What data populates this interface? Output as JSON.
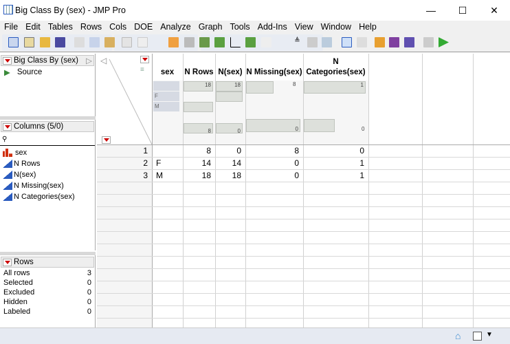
{
  "window": {
    "title": "Big Class By (sex) - JMP Pro",
    "minimize": "—",
    "maximize": "☐",
    "close": "✕"
  },
  "menu": [
    "File",
    "Edit",
    "Tables",
    "Rows",
    "Cols",
    "DOE",
    "Analyze",
    "Graph",
    "Tools",
    "Add-Ins",
    "View",
    "Window",
    "Help"
  ],
  "table_panel": {
    "title": "Big Class By (sex)",
    "source": "Source"
  },
  "columns_panel": {
    "title": "Columns (5/0)",
    "search_placeholder": "",
    "items": [
      "sex",
      "N Rows",
      "N(sex)",
      "N Missing(sex)",
      "N Categories(sex)"
    ]
  },
  "rows_panel": {
    "title": "Rows",
    "items": [
      {
        "label": "All rows",
        "value": "3"
      },
      {
        "label": "Selected",
        "value": "0"
      },
      {
        "label": "Excluded",
        "value": "0"
      },
      {
        "label": "Hidden",
        "value": "0"
      },
      {
        "label": "Labeled",
        "value": "0"
      }
    ]
  },
  "table": {
    "headers": [
      "sex",
      "N Rows",
      "N(sex)",
      "N Missing(sex)",
      "N",
      "Categories(sex)"
    ],
    "summary": {
      "sex_levels": [
        "",
        "F",
        "M"
      ],
      "nrows": {
        "max": "18",
        "min": "8"
      },
      "nsex": {
        "max": "18",
        "min": "0"
      },
      "nmissing": {
        "max": "8",
        "min": "0"
      },
      "ncat": {
        "max": "1",
        "min": "0"
      }
    },
    "rows": [
      {
        "n": "1",
        "sex": "",
        "nrows": "8",
        "nsex": "0",
        "nmissing": "8",
        "ncat": "0"
      },
      {
        "n": "2",
        "sex": "F",
        "nrows": "14",
        "nsex": "14",
        "nmissing": "0",
        "ncat": "1"
      },
      {
        "n": "3",
        "sex": "M",
        "nrows": "18",
        "nsex": "18",
        "nmissing": "0",
        "ncat": "1"
      }
    ]
  },
  "colors": {
    "accent_red": "#cc0000",
    "nominal_red": "#d03010",
    "continuous_blue": "#2a5bbf"
  }
}
